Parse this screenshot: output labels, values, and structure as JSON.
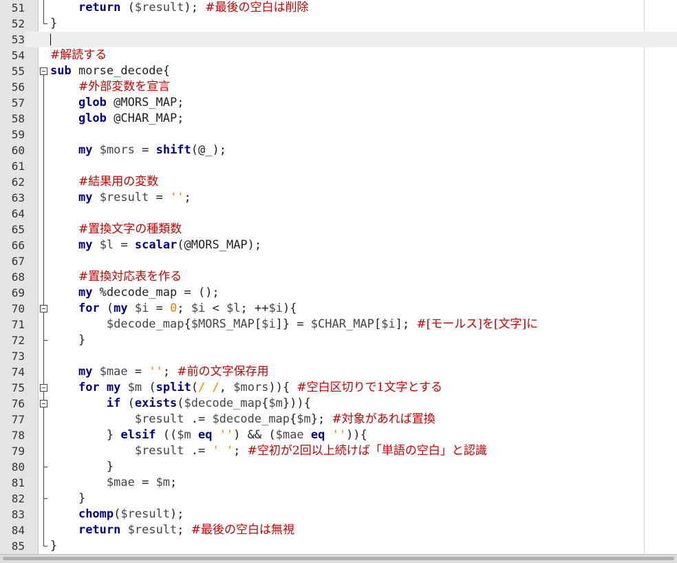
{
  "editor": {
    "lines": [
      {
        "n": "51",
        "segs": [
          {
            "t": "    ",
            "c": "p"
          },
          {
            "t": "return",
            "c": "k"
          },
          {
            "t": " (",
            "c": "p"
          },
          {
            "t": "$result",
            "c": "v"
          },
          {
            "t": "); ",
            "c": "p"
          },
          {
            "t": "#最後の空白は削除",
            "c": "c"
          }
        ]
      },
      {
        "n": "52",
        "segs": [
          {
            "t": "}",
            "c": "p"
          }
        ]
      },
      {
        "n": "53",
        "segs": []
      },
      {
        "n": "54",
        "segs": [
          {
            "t": "#解読する",
            "c": "c"
          }
        ]
      },
      {
        "n": "55",
        "segs": [
          {
            "t": "sub",
            "c": "k"
          },
          {
            "t": " morse_decode{",
            "c": "p"
          }
        ]
      },
      {
        "n": "56",
        "segs": [
          {
            "t": "    ",
            "c": "p"
          },
          {
            "t": "#外部変数を宣言",
            "c": "c"
          }
        ]
      },
      {
        "n": "57",
        "segs": [
          {
            "t": "    ",
            "c": "p"
          },
          {
            "t": "glob",
            "c": "k"
          },
          {
            "t": " @MORS_MAP;",
            "c": "p"
          }
        ]
      },
      {
        "n": "58",
        "segs": [
          {
            "t": "    ",
            "c": "p"
          },
          {
            "t": "glob",
            "c": "k"
          },
          {
            "t": " @CHAR_MAP;",
            "c": "p"
          }
        ]
      },
      {
        "n": "59",
        "segs": []
      },
      {
        "n": "60",
        "segs": [
          {
            "t": "    ",
            "c": "p"
          },
          {
            "t": "my",
            "c": "k"
          },
          {
            "t": " ",
            "c": "p"
          },
          {
            "t": "$mors",
            "c": "v"
          },
          {
            "t": " = ",
            "c": "p"
          },
          {
            "t": "shift",
            "c": "k"
          },
          {
            "t": "(@_);",
            "c": "p"
          }
        ]
      },
      {
        "n": "61",
        "segs": []
      },
      {
        "n": "62",
        "segs": [
          {
            "t": "    ",
            "c": "p"
          },
          {
            "t": "#結果用の変数",
            "c": "c"
          }
        ]
      },
      {
        "n": "63",
        "segs": [
          {
            "t": "    ",
            "c": "p"
          },
          {
            "t": "my",
            "c": "k"
          },
          {
            "t": " ",
            "c": "p"
          },
          {
            "t": "$result",
            "c": "v"
          },
          {
            "t": " = ",
            "c": "p"
          },
          {
            "t": "''",
            "c": "s"
          },
          {
            "t": ";",
            "c": "p"
          }
        ]
      },
      {
        "n": "64",
        "segs": []
      },
      {
        "n": "65",
        "segs": [
          {
            "t": "    ",
            "c": "p"
          },
          {
            "t": "#置換文字の種類数",
            "c": "c"
          }
        ]
      },
      {
        "n": "66",
        "segs": [
          {
            "t": "    ",
            "c": "p"
          },
          {
            "t": "my",
            "c": "k"
          },
          {
            "t": " ",
            "c": "p"
          },
          {
            "t": "$l",
            "c": "v"
          },
          {
            "t": " = ",
            "c": "p"
          },
          {
            "t": "scalar",
            "c": "k"
          },
          {
            "t": "(@MORS_MAP);",
            "c": "p"
          }
        ]
      },
      {
        "n": "67",
        "segs": []
      },
      {
        "n": "68",
        "segs": [
          {
            "t": "    ",
            "c": "p"
          },
          {
            "t": "#置換対応表を作る",
            "c": "c"
          }
        ]
      },
      {
        "n": "69",
        "segs": [
          {
            "t": "    ",
            "c": "p"
          },
          {
            "t": "my",
            "c": "k"
          },
          {
            "t": " %decode_map = ();",
            "c": "p"
          }
        ]
      },
      {
        "n": "70",
        "segs": [
          {
            "t": "    ",
            "c": "p"
          },
          {
            "t": "for",
            "c": "k"
          },
          {
            "t": " (",
            "c": "p"
          },
          {
            "t": "my",
            "c": "k"
          },
          {
            "t": " ",
            "c": "p"
          },
          {
            "t": "$i",
            "c": "v"
          },
          {
            "t": " = ",
            "c": "p"
          },
          {
            "t": "0",
            "c": "s"
          },
          {
            "t": "; ",
            "c": "p"
          },
          {
            "t": "$i",
            "c": "v"
          },
          {
            "t": " < ",
            "c": "p"
          },
          {
            "t": "$l",
            "c": "v"
          },
          {
            "t": "; ++",
            "c": "p"
          },
          {
            "t": "$i",
            "c": "v"
          },
          {
            "t": "){",
            "c": "p"
          }
        ]
      },
      {
        "n": "71",
        "segs": [
          {
            "t": "        ",
            "c": "p"
          },
          {
            "t": "$decode_map",
            "c": "v"
          },
          {
            "t": "{",
            "c": "p"
          },
          {
            "t": "$MORS_MAP",
            "c": "v"
          },
          {
            "t": "[",
            "c": "p"
          },
          {
            "t": "$i",
            "c": "v"
          },
          {
            "t": "]} = ",
            "c": "p"
          },
          {
            "t": "$CHAR_MAP",
            "c": "v"
          },
          {
            "t": "[",
            "c": "p"
          },
          {
            "t": "$i",
            "c": "v"
          },
          {
            "t": "]; ",
            "c": "p"
          },
          {
            "t": "#[モールス]を[文字]に",
            "c": "c"
          }
        ]
      },
      {
        "n": "72",
        "segs": [
          {
            "t": "    }",
            "c": "p"
          }
        ]
      },
      {
        "n": "73",
        "segs": []
      },
      {
        "n": "74",
        "segs": [
          {
            "t": "    ",
            "c": "p"
          },
          {
            "t": "my",
            "c": "k"
          },
          {
            "t": " ",
            "c": "p"
          },
          {
            "t": "$mae",
            "c": "v"
          },
          {
            "t": " = ",
            "c": "p"
          },
          {
            "t": "''",
            "c": "s"
          },
          {
            "t": "; ",
            "c": "p"
          },
          {
            "t": "#前の文字保存用",
            "c": "c"
          }
        ]
      },
      {
        "n": "75",
        "segs": [
          {
            "t": "    ",
            "c": "p"
          },
          {
            "t": "for",
            "c": "k"
          },
          {
            "t": " ",
            "c": "p"
          },
          {
            "t": "my",
            "c": "k"
          },
          {
            "t": " ",
            "c": "p"
          },
          {
            "t": "$m",
            "c": "v"
          },
          {
            "t": " (",
            "c": "p"
          },
          {
            "t": "split",
            "c": "k"
          },
          {
            "t": "(",
            "c": "p"
          },
          {
            "t": "/ /",
            "c": "s"
          },
          {
            "t": ", ",
            "c": "p"
          },
          {
            "t": "$mors",
            "c": "v"
          },
          {
            "t": ")){ ",
            "c": "p"
          },
          {
            "t": "#空白区切りで1文字とする",
            "c": "c"
          }
        ]
      },
      {
        "n": "76",
        "segs": [
          {
            "t": "        ",
            "c": "p"
          },
          {
            "t": "if",
            "c": "k"
          },
          {
            "t": " (",
            "c": "p"
          },
          {
            "t": "exists",
            "c": "k"
          },
          {
            "t": "(",
            "c": "p"
          },
          {
            "t": "$decode_map",
            "c": "v"
          },
          {
            "t": "{",
            "c": "p"
          },
          {
            "t": "$m",
            "c": "v"
          },
          {
            "t": "})){",
            "c": "p"
          }
        ]
      },
      {
        "n": "77",
        "segs": [
          {
            "t": "            ",
            "c": "p"
          },
          {
            "t": "$result",
            "c": "v"
          },
          {
            "t": " .= ",
            "c": "p"
          },
          {
            "t": "$decode_map",
            "c": "v"
          },
          {
            "t": "{",
            "c": "p"
          },
          {
            "t": "$m",
            "c": "v"
          },
          {
            "t": "}; ",
            "c": "p"
          },
          {
            "t": "#対象があれば置換",
            "c": "c"
          }
        ]
      },
      {
        "n": "78",
        "segs": [
          {
            "t": "        } ",
            "c": "p"
          },
          {
            "t": "elsif",
            "c": "k"
          },
          {
            "t": " ((",
            "c": "p"
          },
          {
            "t": "$m",
            "c": "v"
          },
          {
            "t": " ",
            "c": "p"
          },
          {
            "t": "eq",
            "c": "k"
          },
          {
            "t": " ",
            "c": "p"
          },
          {
            "t": "''",
            "c": "s"
          },
          {
            "t": ") && (",
            "c": "p"
          },
          {
            "t": "$mae",
            "c": "v"
          },
          {
            "t": " ",
            "c": "p"
          },
          {
            "t": "eq",
            "c": "k"
          },
          {
            "t": " ",
            "c": "p"
          },
          {
            "t": "''",
            "c": "s"
          },
          {
            "t": ")){",
            "c": "p"
          }
        ]
      },
      {
        "n": "79",
        "segs": [
          {
            "t": "            ",
            "c": "p"
          },
          {
            "t": "$result",
            "c": "v"
          },
          {
            "t": " .= ",
            "c": "p"
          },
          {
            "t": "' '",
            "c": "s"
          },
          {
            "t": "; ",
            "c": "p"
          },
          {
            "t": "#空初が2回以上続けば「単語の空白」と認識",
            "c": "c"
          }
        ]
      },
      {
        "n": "80",
        "segs": [
          {
            "t": "        }",
            "c": "p"
          }
        ]
      },
      {
        "n": "81",
        "segs": [
          {
            "t": "        ",
            "c": "p"
          },
          {
            "t": "$mae",
            "c": "v"
          },
          {
            "t": " = ",
            "c": "p"
          },
          {
            "t": "$m",
            "c": "v"
          },
          {
            "t": ";",
            "c": "p"
          }
        ]
      },
      {
        "n": "82",
        "segs": [
          {
            "t": "    }",
            "c": "p"
          }
        ]
      },
      {
        "n": "83",
        "segs": [
          {
            "t": "    ",
            "c": "p"
          },
          {
            "t": "chomp",
            "c": "k"
          },
          {
            "t": "(",
            "c": "p"
          },
          {
            "t": "$result",
            "c": "v"
          },
          {
            "t": ");",
            "c": "p"
          }
        ]
      },
      {
        "n": "84",
        "segs": [
          {
            "t": "    ",
            "c": "p"
          },
          {
            "t": "return",
            "c": "k"
          },
          {
            "t": " ",
            "c": "p"
          },
          {
            "t": "$result",
            "c": "v"
          },
          {
            "t": "; ",
            "c": "p"
          },
          {
            "t": "#最後の空白は無視",
            "c": "c"
          }
        ]
      },
      {
        "n": "85",
        "segs": [
          {
            "t": "}",
            "c": "p"
          }
        ]
      }
    ]
  }
}
